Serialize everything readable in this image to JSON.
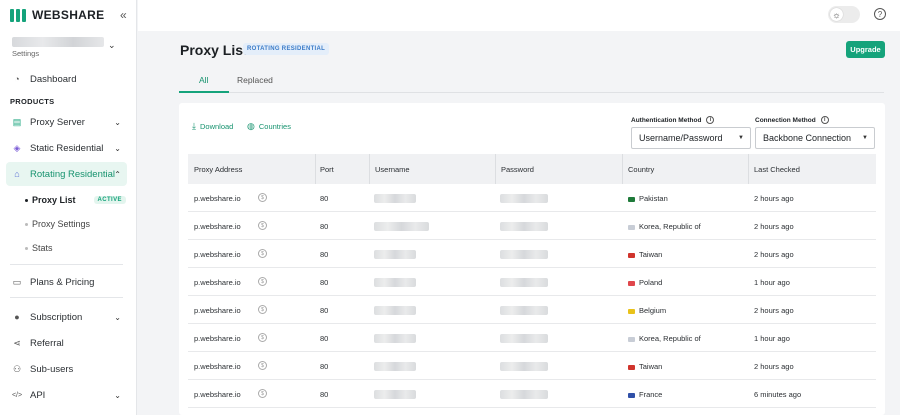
{
  "brand": {
    "name": "WEBSHARE"
  },
  "account": {
    "sub_label": "Settings"
  },
  "sidebar": {
    "dashboard": "Dashboard",
    "section_label": "PRODUCTS",
    "proxy_server": "Proxy Server",
    "static_residential": "Static Residential",
    "rotating_residential": "Rotating Residential",
    "sub_items": {
      "proxy_list": "Proxy List",
      "active_badge": "ACTIVE",
      "proxy_settings": "Proxy Settings",
      "stats": "Stats"
    },
    "plans_pricing": "Plans & Pricing",
    "subscription": "Subscription",
    "referral": "Referral",
    "sub_users": "Sub-users",
    "api": "API"
  },
  "page": {
    "title": "Proxy List",
    "title_badge": "ROTATING RESIDENTIAL",
    "upgrade_label": "Upgrade",
    "tabs": [
      "All",
      "Replaced"
    ]
  },
  "toolbar": {
    "download": "Download",
    "countries": "Countries",
    "auth_label": "Authentication Method",
    "auth_value": "Username/Password",
    "conn_label": "Connection Method",
    "conn_value": "Backbone Connection"
  },
  "table": {
    "headers": [
      "Proxy Address",
      "Port",
      "Username",
      "Password",
      "Country",
      "Last Checked"
    ],
    "rows": [
      {
        "address": "p.webshare.io",
        "port": "80",
        "country": "Pakistan",
        "flag_color": "#1f7a3a",
        "last_checked": "2 hours ago"
      },
      {
        "address": "p.webshare.io",
        "port": "80",
        "country": "Korea, Republic of",
        "flag_color": "#c8cdd6",
        "last_checked": "2 hours ago"
      },
      {
        "address": "p.webshare.io",
        "port": "80",
        "country": "Taiwan",
        "flag_color": "#d0342c",
        "last_checked": "2 hours ago"
      },
      {
        "address": "p.webshare.io",
        "port": "80",
        "country": "Poland",
        "flag_color": "#e0474c",
        "last_checked": "1 hour ago"
      },
      {
        "address": "p.webshare.io",
        "port": "80",
        "country": "Belgium",
        "flag_color": "#e9c21a",
        "last_checked": "2 hours ago"
      },
      {
        "address": "p.webshare.io",
        "port": "80",
        "country": "Korea, Republic of",
        "flag_color": "#c8cdd6",
        "last_checked": "1 hour ago"
      },
      {
        "address": "p.webshare.io",
        "port": "80",
        "country": "Taiwan",
        "flag_color": "#d0342c",
        "last_checked": "2 hours ago"
      },
      {
        "address": "p.webshare.io",
        "port": "80",
        "country": "France",
        "flag_color": "#3050a8",
        "last_checked": "6 minutes ago"
      }
    ]
  },
  "colors": {
    "accent": "#15a37b",
    "badge_blue": "#3a7bc8"
  }
}
